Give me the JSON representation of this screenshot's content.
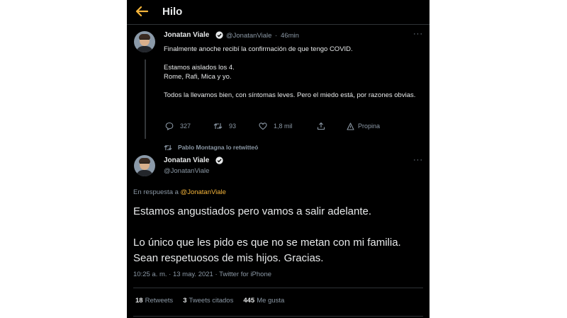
{
  "header": {
    "title": "Hilo"
  },
  "tweet1": {
    "name": "Jonatan Viale",
    "handle": "@JonatanViale",
    "dot": "·",
    "time": "46min",
    "text": "Finalmente anoche recibí la confirmación de que tengo COVID.\n\nEstamos aislados los 4.\nRome, Rafi, Mica y yo.\n\nTodos la llevamos bien, con síntomas leves. Pero el miedo está, por razones obvias.",
    "actions": {
      "replies": "327",
      "retweets": "93",
      "likes": "1,8 mil",
      "promo": "Propina"
    }
  },
  "retweet_notice": "Pablo Montagna lo retwitteó",
  "tweet2": {
    "name": "Jonatan Viale",
    "handle": "@JonatanViale",
    "reply_prefix": "En respuesta a",
    "reply_mention": "@JonatanViale",
    "text": "Estamos angustiados pero vamos a salir adelante.\n\nLo único que les pido es que no se metan con mi familia. Sean respetuosos de mis hijos. Gracias.",
    "timestamp": "10:25 a. m. · 13 may. 2021 · Twitter for iPhone",
    "stats": {
      "retweets_count": "18",
      "retweets_label": "Retweets",
      "quotes_count": "3",
      "quotes_label": "Tweets citados",
      "likes_count": "445",
      "likes_label": "Me gusta"
    }
  },
  "more_glyph": "···",
  "colors": {
    "background": "#000000",
    "accent": "#f4b43a",
    "muted": "#8b98a5",
    "text": "#e7e9ea",
    "verified": "#e7e9ea"
  }
}
